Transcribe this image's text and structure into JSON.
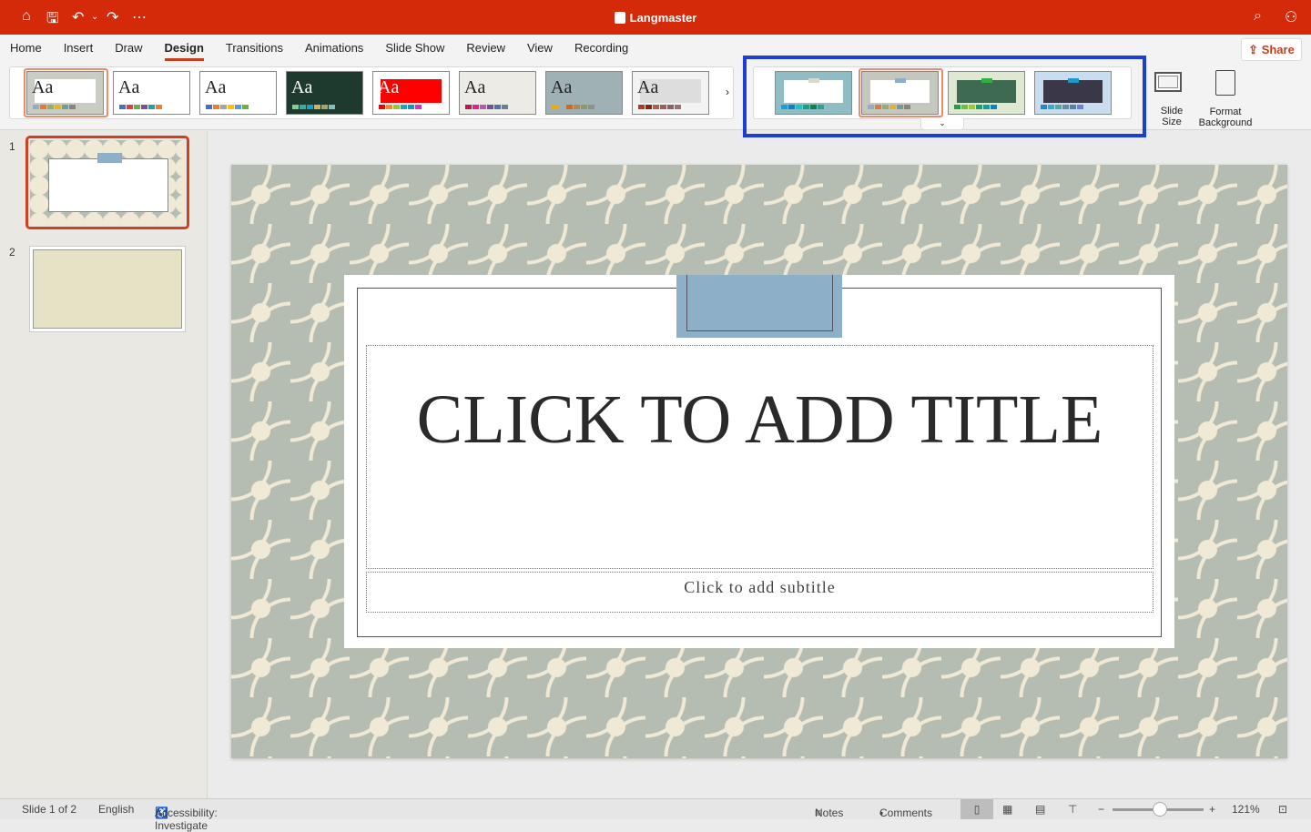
{
  "app": {
    "title": "Langmaster"
  },
  "tabs": [
    "Home",
    "Insert",
    "Draw",
    "Design",
    "Transitions",
    "Animations",
    "Slide Show",
    "Review",
    "View",
    "Recording"
  ],
  "active_tab": "Design",
  "share_label": "Share",
  "themes": [
    {
      "bg": "#c9ccc3",
      "inner": "#fff",
      "aa": "Aa",
      "selected": true,
      "colors": [
        "#8eafc8",
        "#e0793a",
        "#9aa872",
        "#e5b32a",
        "#6f9f8e",
        "#8f7f7f"
      ]
    },
    {
      "bg": "#fff",
      "inner": "#fff",
      "aa": "Aa",
      "colors": [
        "#4472c4",
        "#e04040",
        "#70ad47",
        "#7b4ea3",
        "#1aa3a3",
        "#ed7d31"
      ]
    },
    {
      "bg": "#fff",
      "inner": "#fff",
      "aa": "Aa",
      "colors": [
        "#4472c4",
        "#ed7d31",
        "#a5a5a5",
        "#ffc000",
        "#5b9bd5",
        "#70ad47"
      ]
    },
    {
      "bg": "#1e3a2f",
      "inner": "#1e3a2f",
      "aa": "Aa",
      "light": true,
      "colors": [
        "#7bd389",
        "#2ab3a3",
        "#19a0c4",
        "#c4b85a",
        "#b0a060",
        "#7fc0c0"
      ]
    },
    {
      "bg": "#fff",
      "inner": "#f00",
      "aa": "Aa",
      "light": true,
      "colors": [
        "#e00",
        "#f28c28",
        "#9ac43a",
        "#1aa6b7",
        "#1a8fc4",
        "#c43ac4"
      ]
    },
    {
      "bg": "#ecebe6",
      "inner": "#ecebe6",
      "aa": "Aa",
      "colors": [
        "#c4124a",
        "#e0208a",
        "#c050c0",
        "#7050a0",
        "#5070b0",
        "#6080a0"
      ]
    },
    {
      "bg": "#9fb1b5",
      "inner": "#9fb1b5",
      "aa": "Aa",
      "colors": [
        "#f2a900",
        "#9fb1b5",
        "#d2691e",
        "#b08a50",
        "#8a9a70",
        "#909090"
      ]
    },
    {
      "bg": "#f3f3f3",
      "inner": "#ddd",
      "aa": "Aa",
      "colors": [
        "#b03a1a",
        "#902010",
        "#b06040",
        "#a06050",
        "#906060",
        "#a07070"
      ]
    }
  ],
  "variants": [
    {
      "bg": "#8fbdc4",
      "inner": "#fff",
      "tab": "#d8d8cc",
      "colors": [
        "#1aa0d8",
        "#1a7ac4",
        "#1ac4c4",
        "#1aa080",
        "#108050",
        "#30a090"
      ]
    },
    {
      "bg": "#c4c7be",
      "inner": "#fff",
      "tab": "#8eafc8",
      "selected": true,
      "colors": [
        "#8eafc8",
        "#e0793a",
        "#9aa872",
        "#e5b32a",
        "#6f9f8e",
        "#8f7f7f"
      ]
    },
    {
      "bg": "#dfe8d0",
      "inner": "#3e6a52",
      "tab": "#30b040",
      "colors": [
        "#20a040",
        "#70c040",
        "#a0c830",
        "#20a070",
        "#10a0a0",
        "#1080c0"
      ]
    },
    {
      "bg": "#c8ddf0",
      "inner": "#3a3848",
      "tab": "#1a9ac8",
      "colors": [
        "#1a8ac8",
        "#2ab0c0",
        "#40b0a0",
        "#6090a0",
        "#5080b0",
        "#7080d0"
      ]
    }
  ],
  "tools": {
    "slide_size": "Slide Size",
    "format_background": "Format Background"
  },
  "slides": [
    {
      "num": "1"
    },
    {
      "num": "2"
    }
  ],
  "slide": {
    "title": "CLICK TO ADD TITLE",
    "subtitle": "Click to add subtitle"
  },
  "status": {
    "slide": "Slide 1 of 2",
    "language": "English",
    "accessibility": "Accessibility: Investigate",
    "notes": "Notes",
    "comments": "Comments",
    "zoom": "121%",
    "zoom_level_percent": 121
  },
  "colors": {
    "accent": "#d42a0a",
    "highlight": "#1b3fd0"
  }
}
